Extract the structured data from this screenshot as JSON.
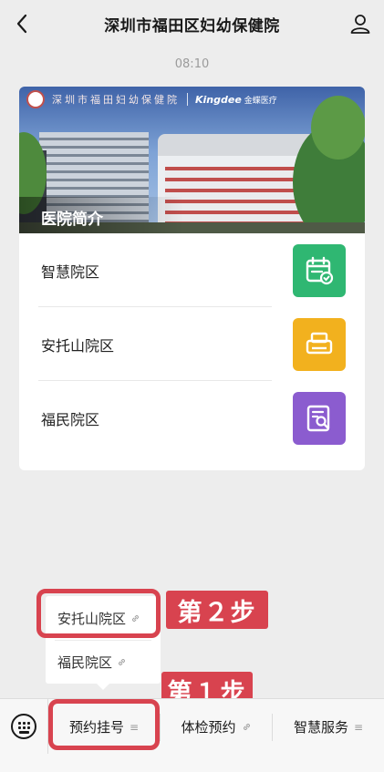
{
  "header": {
    "title": "深圳市福田区妇幼保健院",
    "back_icon": "chevron-left-icon",
    "user_icon": "user-icon"
  },
  "chat": {
    "timestamp": "08:10"
  },
  "card": {
    "banner": {
      "hospital_name": "深圳市福田妇幼保健院",
      "partner": "Kingdee",
      "partner_cn": "金蝶医疗",
      "caption": "医院简介"
    },
    "items": [
      {
        "label": "智慧院区",
        "icon": "calendar-check-icon",
        "color": "#2fb772"
      },
      {
        "label": "安托山院区",
        "icon": "printer-icon",
        "color": "#f2b11e"
      },
      {
        "label": "福民院区",
        "icon": "document-search-icon",
        "color": "#8b5ccf"
      }
    ]
  },
  "popup": {
    "items": [
      {
        "label": "安托山院区",
        "icon": "link-icon"
      },
      {
        "label": "福民院区",
        "icon": "link-icon"
      }
    ]
  },
  "annotations": {
    "step1": "第１步",
    "step2": "第２步",
    "highlight_color": "#d8434f"
  },
  "bottom_bar": {
    "keyboard_icon": "keyboard-icon",
    "items": [
      {
        "label": "预约挂号",
        "icon": "menu-lines-icon",
        "sub": "≡"
      },
      {
        "label": "体检预约",
        "icon": "link-icon",
        "sub": "🔗"
      },
      {
        "label": "智慧服务",
        "icon": "menu-lines-icon",
        "sub": "≡"
      }
    ]
  }
}
